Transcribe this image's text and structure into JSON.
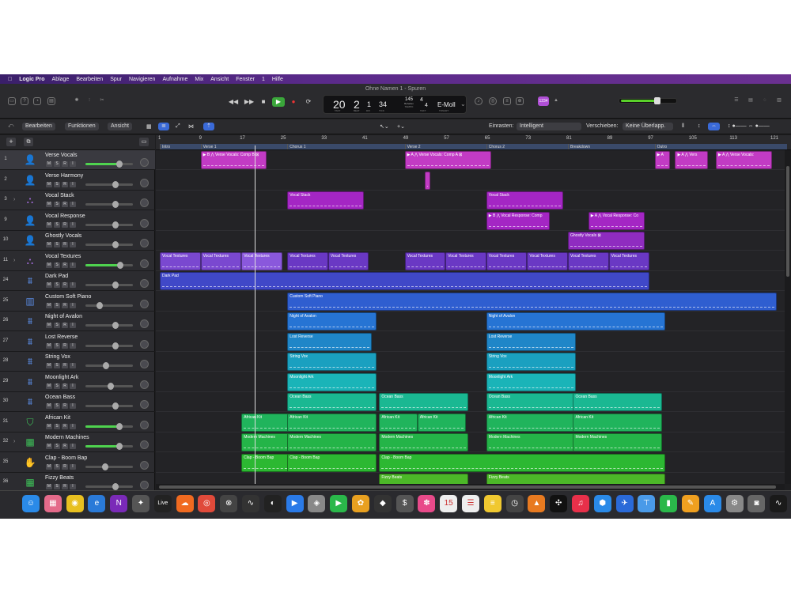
{
  "menubar": {
    "apple": "",
    "app": "Logic Pro",
    "items": [
      "Ablage",
      "Bearbeiten",
      "Spur",
      "Navigieren",
      "Aufnahme",
      "Mix",
      "Ansicht",
      "Fenster",
      "1",
      "Hilfe"
    ]
  },
  "window": {
    "title": "Ohne Namen 1 - Spuren"
  },
  "lcd": {
    "bar": "20",
    "beat": "2",
    "div": "1",
    "tick": "34",
    "tempo": "145",
    "tempo_mode": "Behalten",
    "sig_top": "4",
    "sig_bottom": "4",
    "key": "E-Moll",
    "lbl_bar": "TAKT",
    "lbl_beat": "BEAT",
    "lbl_div": "DIV",
    "lbl_tick": "TICK",
    "lbl_tempo": "TEMPO",
    "lbl_sig": "TAKT",
    "lbl_key": "TONART"
  },
  "badge": "1234",
  "controlbar": {
    "edit": "Bearbeiten",
    "functions": "Funktionen",
    "view": "Ansicht",
    "snap_label": "Einrasten:",
    "snap_value": "Intelligent",
    "drag_label": "Verschieben:",
    "drag_value": "Keine Überlapp."
  },
  "ruler": {
    "ticks": [
      "1",
      "9",
      "17",
      "25",
      "33",
      "41",
      "49",
      "57",
      "65",
      "73",
      "81",
      "89",
      "97",
      "105",
      "113",
      "121"
    ],
    "markers": [
      "Intro",
      "Verse 1",
      "Chorus 1",
      "Verse 2",
      "Chorus 2",
      "Breakdown",
      "Outro"
    ]
  },
  "tracks": [
    {
      "num": "1",
      "name": "Verse Vocals",
      "icon": "singer-icon",
      "sel": true,
      "fader": 0.7
    },
    {
      "num": "2",
      "name": "Verse Harmony",
      "icon": "singer-icon",
      "fader": 0.6
    },
    {
      "num": "3",
      "name": "Vocal Stack",
      "icon": "stack-icon",
      "disc": true,
      "fader": 0.6
    },
    {
      "num": "9",
      "name": "Vocal Response",
      "icon": "singer-icon",
      "fader": 0.6
    },
    {
      "num": "10",
      "name": "Ghostly Vocals",
      "icon": "singer-icon",
      "fader": 0.6
    },
    {
      "num": "11",
      "name": "Vocal Textures",
      "icon": "stack-icon",
      "disc": true,
      "fader": 0.72
    },
    {
      "num": "24",
      "name": "Dark Pad",
      "icon": "synth-icon",
      "fader": 0.6
    },
    {
      "num": "25",
      "name": "Custom Soft Piano",
      "icon": "piano-icon",
      "fader": 0.25
    },
    {
      "num": "26",
      "name": "Night of Avalon",
      "icon": "synth-icon",
      "fader": 0.6
    },
    {
      "num": "27",
      "name": "Lost Reverse",
      "icon": "synth-icon",
      "fader": 0.6
    },
    {
      "num": "28",
      "name": "String Vox",
      "icon": "synth-icon",
      "fader": 0.4
    },
    {
      "num": "29",
      "name": "Moonlight Ark",
      "icon": "synth-icon",
      "fader": 0.5
    },
    {
      "num": "30",
      "name": "Ocean Bass",
      "icon": "synth-icon",
      "fader": 0.6
    },
    {
      "num": "31",
      "name": "African Kit",
      "icon": "drum-icon",
      "fader": 0.7
    },
    {
      "num": "32",
      "name": "Modern Machines",
      "icon": "drum-machine-icon",
      "disc": true,
      "fader": 0.7
    },
    {
      "num": "35",
      "name": "Clap - Boom Bap",
      "icon": "clap-icon",
      "fader": 0.38
    },
    {
      "num": "36",
      "name": "Fizzy Beats",
      "icon": "drum-machine-icon",
      "fader": 0.6
    }
  ],
  "regions": [
    {
      "lane": 0,
      "bar": 9,
      "len": 13,
      "name": "▶ B ⋀ Verse Vocals: Comp B ⊠",
      "color": "#c23bc4"
    },
    {
      "lane": 0,
      "bar": 49,
      "len": 17,
      "name": "▶ A ⋀ Verse Vocals: Comp A ⊠",
      "color": "#c23bc4"
    },
    {
      "lane": 0,
      "bar": 98,
      "len": 3,
      "name": "▶ A",
      "color": "#c23bc4"
    },
    {
      "lane": 0,
      "bar": 102,
      "len": 6.5,
      "name": "▶ A ⋀ Vers",
      "color": "#c23bc4"
    },
    {
      "lane": 0,
      "bar": 110,
      "len": 11,
      "name": "▶ A ⋀ Verse Vocals:",
      "color": "#c23bc4"
    },
    {
      "lane": 1,
      "bar": 53,
      "len": 1,
      "name": "",
      "color": "#c23bc4"
    },
    {
      "lane": 2,
      "bar": 26,
      "len": 15,
      "name": "Vocal Stack",
      "color": "#a426c4"
    },
    {
      "lane": 2,
      "bar": 65,
      "len": 15,
      "name": "Vocal Stack",
      "color": "#a426c4"
    },
    {
      "lane": 3,
      "bar": 65,
      "len": 12.5,
      "name": "▶ B ⋀ Vocal Response: Comp",
      "color": "#a426c4"
    },
    {
      "lane": 3,
      "bar": 85,
      "len": 11,
      "name": "▶ A ⋀ Vocal Response: Co",
      "color": "#a426c4"
    },
    {
      "lane": 4,
      "bar": 81,
      "len": 15,
      "name": "Ghostly Vocals ⊠",
      "color": "#8f2cc0"
    },
    {
      "lane": 5,
      "bar": 1,
      "len": 8,
      "name": "Vocal Textures",
      "color": "#7a48d0"
    },
    {
      "lane": 5,
      "bar": 9,
      "len": 8,
      "name": "Vocal Textures",
      "color": "#7a48d0"
    },
    {
      "lane": 5,
      "bar": 17,
      "len": 8,
      "name": "Vocal Textures",
      "color": "#8a58dc"
    },
    {
      "lane": 5,
      "bar": 26,
      "len": 8,
      "name": "Vocal Textures",
      "color": "#6a38c4"
    },
    {
      "lane": 5,
      "bar": 34,
      "len": 8,
      "name": "Vocal Textures",
      "color": "#6a38c4"
    },
    {
      "lane": 5,
      "bar": 49,
      "len": 8,
      "name": "Vocal Textures",
      "color": "#6a38c4"
    },
    {
      "lane": 5,
      "bar": 57,
      "len": 8,
      "name": "Vocal Textures",
      "color": "#6a38c4"
    },
    {
      "lane": 5,
      "bar": 65,
      "len": 8,
      "name": "Vocal Textures",
      "color": "#6a38c4"
    },
    {
      "lane": 5,
      "bar": 73,
      "len": 8,
      "name": "Vocal Textures",
      "color": "#6a38c4"
    },
    {
      "lane": 5,
      "bar": 81,
      "len": 8,
      "name": "Vocal Textures",
      "color": "#6a38c4"
    },
    {
      "lane": 5,
      "bar": 89,
      "len": 8,
      "name": "Vocal Textures",
      "color": "#6a38c4"
    },
    {
      "lane": 6,
      "bar": 1,
      "len": 96,
      "name": "Dark Pad",
      "color": "#4048c8"
    },
    {
      "lane": 7,
      "bar": 26,
      "len": 96,
      "name": "Custom Soft Piano",
      "color": "#2f5ed0"
    },
    {
      "lane": 8,
      "bar": 26,
      "len": 17.5,
      "name": "Night of Avalon",
      "color": "#2674d4"
    },
    {
      "lane": 8,
      "bar": 65,
      "len": 35,
      "name": "Night of Avalon",
      "color": "#2674d4"
    },
    {
      "lane": 9,
      "bar": 26,
      "len": 16.5,
      "name": "Lost Reverse",
      "color": "#1f86c8"
    },
    {
      "lane": 9,
      "bar": 65,
      "len": 17.5,
      "name": "Lost Reverse",
      "color": "#1f86c8"
    },
    {
      "lane": 10,
      "bar": 26,
      "len": 17.5,
      "name": "String Vox",
      "color": "#1aa0c0"
    },
    {
      "lane": 10,
      "bar": 65,
      "len": 17.5,
      "name": "String Vox",
      "color": "#1aa0c0"
    },
    {
      "lane": 11,
      "bar": 26,
      "len": 17.5,
      "name": "Moonlight Ark",
      "color": "#1ab4b8"
    },
    {
      "lane": 11,
      "bar": 65,
      "len": 17.5,
      "name": "Moonlight Ark",
      "color": "#1ab4b8"
    },
    {
      "lane": 12,
      "bar": 26,
      "len": 17.5,
      "name": "Ocean Bass",
      "color": "#1ab892"
    },
    {
      "lane": 12,
      "bar": 44,
      "len": 17.5,
      "name": "Ocean Bass",
      "color": "#1ab892"
    },
    {
      "lane": 12,
      "bar": 65,
      "len": 17.5,
      "name": "Ocean Bass",
      "color": "#1ab892"
    },
    {
      "lane": 12,
      "bar": 82,
      "len": 17.5,
      "name": "Ocean Bass",
      "color": "#1ab892"
    },
    {
      "lane": 13,
      "bar": 17,
      "len": 9.5,
      "name": "African Kit",
      "color": "#20b45c"
    },
    {
      "lane": 13,
      "bar": 26,
      "len": 17.5,
      "name": "African Kit",
      "color": "#20b45c"
    },
    {
      "lane": 13,
      "bar": 44,
      "len": 7.5,
      "name": "African Kit",
      "color": "#20b45c"
    },
    {
      "lane": 13,
      "bar": 51.5,
      "len": 9.5,
      "name": "African Kit",
      "color": "#20b45c"
    },
    {
      "lane": 13,
      "bar": 65,
      "len": 17.5,
      "name": "African Kit",
      "color": "#20b45c"
    },
    {
      "lane": 13,
      "bar": 82,
      "len": 17.5,
      "name": "African Kit",
      "color": "#20b45c"
    },
    {
      "lane": 14,
      "bar": 17,
      "len": 9.5,
      "name": "Modern Machines",
      "color": "#24b448"
    },
    {
      "lane": 14,
      "bar": 26,
      "len": 17.5,
      "name": "Modern Machines",
      "color": "#24b448"
    },
    {
      "lane": 14,
      "bar": 44,
      "len": 17.5,
      "name": "Modern Machines",
      "color": "#24b448"
    },
    {
      "lane": 14,
      "bar": 65,
      "len": 17.5,
      "name": "Modern Machines",
      "color": "#24b448"
    },
    {
      "lane": 14,
      "bar": 82,
      "len": 17.5,
      "name": "Modern Machines",
      "color": "#24b448"
    },
    {
      "lane": 15,
      "bar": 17,
      "len": 9.5,
      "name": "Clap - Boom Bap",
      "color": "#2cb832"
    },
    {
      "lane": 15,
      "bar": 26,
      "len": 17.5,
      "name": "Clap - Boom Bap",
      "color": "#2cb832"
    },
    {
      "lane": 15,
      "bar": 44,
      "len": 56,
      "name": "Clap - Boom Bap",
      "color": "#2cb832"
    },
    {
      "lane": 16,
      "bar": 44,
      "len": 17.5,
      "name": "Fizzy Beats",
      "color": "#4cb828"
    },
    {
      "lane": 16,
      "bar": 65,
      "len": 35,
      "name": "Fizzy Beats",
      "color": "#4cb828"
    }
  ],
  "dock": [
    {
      "name": "finder-icon",
      "c": "#2a8ae8",
      "t": "☺"
    },
    {
      "name": "launchpad-icon",
      "c": "#e46a8a",
      "t": "▦"
    },
    {
      "name": "chrome-icon",
      "c": "#e8c020",
      "t": "◉"
    },
    {
      "name": "edge-icon",
      "c": "#2a7ad8",
      "t": "e"
    },
    {
      "name": "onenote-icon",
      "c": "#7a2ab8",
      "t": "N"
    },
    {
      "name": "davinci-icon",
      "c": "#555",
      "t": "✦"
    },
    {
      "name": "live-icon",
      "c": "#222",
      "t": "Live"
    },
    {
      "name": "soundcloud-icon",
      "c": "#f06a20",
      "t": "☁"
    },
    {
      "name": "record-icon",
      "c": "#e04a3a",
      "t": "◎"
    },
    {
      "name": "logic-icon",
      "c": "#444",
      "t": "⊗"
    },
    {
      "name": "waveform-icon",
      "c": "#333",
      "t": "∿"
    },
    {
      "name": "obs-icon",
      "c": "#222",
      "t": "◐"
    },
    {
      "name": "zoom-icon",
      "c": "#2a7ae8",
      "t": "▶"
    },
    {
      "name": "podcast-icon",
      "c": "#888",
      "t": "◈"
    },
    {
      "name": "facetime-icon",
      "c": "#2ab84a",
      "t": "▶"
    },
    {
      "name": "pineapple-icon",
      "c": "#e8a020",
      "t": "✿"
    },
    {
      "name": "resolve-icon",
      "c": "#333",
      "t": "◆"
    },
    {
      "name": "dollar-icon",
      "c": "#555",
      "t": "$"
    },
    {
      "name": "photos-icon",
      "c": "#e84a8a",
      "t": "✽"
    },
    {
      "name": "calendar-icon",
      "c": "#eee",
      "t": "15"
    },
    {
      "name": "reminders-icon",
      "c": "#eee",
      "t": "☰"
    },
    {
      "name": "notes-icon",
      "c": "#f0c830",
      "t": "≡"
    },
    {
      "name": "clock-icon",
      "c": "#444",
      "t": "◷"
    },
    {
      "name": "vlc-icon",
      "c": "#e87a20",
      "t": "▲"
    },
    {
      "name": "tidal-icon",
      "c": "#111",
      "t": "✣"
    },
    {
      "name": "music-icon",
      "c": "#e8304a",
      "t": "♫"
    },
    {
      "name": "shield-icon",
      "c": "#2a8ae8",
      "t": "⬢"
    },
    {
      "name": "bird-icon",
      "c": "#2a6ad8",
      "t": "✈"
    },
    {
      "name": "keynote-icon",
      "c": "#4a9ae8",
      "t": "⊤"
    },
    {
      "name": "numbers-icon",
      "c": "#2ab84a",
      "t": "▮"
    },
    {
      "name": "pages-icon",
      "c": "#f0a020",
      "t": "✎"
    },
    {
      "name": "appstore-icon",
      "c": "#2a8ae8",
      "t": "A"
    },
    {
      "name": "settings-icon",
      "c": "#888",
      "t": "⚙"
    },
    {
      "name": "screenshot-icon",
      "c": "#666",
      "t": "◙"
    },
    {
      "name": "activity-icon",
      "c": "#1a1a1a",
      "t": "∿"
    }
  ],
  "colors": {
    "accent": "#b04fd6",
    "play": "#3aa63a",
    "record": "#e33"
  }
}
